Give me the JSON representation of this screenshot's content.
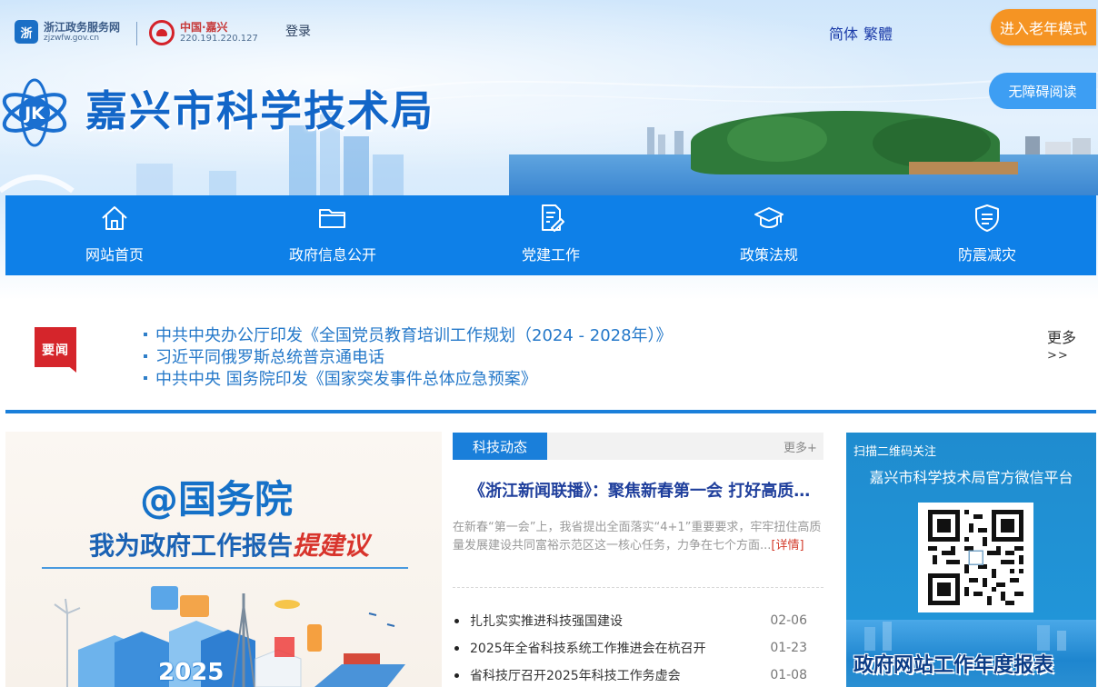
{
  "header": {
    "zj_portal_name": "浙江政务服务网",
    "zj_portal_domain": "zjzwfw.gov.cn",
    "zj_logo_glyph": "浙",
    "cn_region_name": "中国·嘉兴",
    "cn_region_ip": "220.191.220.127",
    "login_label": "登录",
    "lang_simplified": "简体",
    "lang_traditional": "繁體",
    "elder_mode_label": "进入老年模式",
    "accessibility_label": "无障碍阅读",
    "site_title": "嘉兴市科学技术局",
    "logo_letters": "JK"
  },
  "colors": {
    "nav_blue": "#0e80e8",
    "accent_orange": "#f59423",
    "badge_red": "#d5252b",
    "link_blue": "#2478c9",
    "headline_blue": "#1f3f9c"
  },
  "nav": {
    "items": [
      {
        "label": "网站首页",
        "icon": "home-icon"
      },
      {
        "label": "政府信息公开",
        "icon": "folder-icon"
      },
      {
        "label": "党建工作",
        "icon": "document-edit-icon"
      },
      {
        "label": "政策法规",
        "icon": "graduation-cap-icon"
      },
      {
        "label": "防震减灾",
        "icon": "shield-icon"
      }
    ]
  },
  "news": {
    "badge": "要闻",
    "items": [
      "中共中央办公厅印发《全国党员教育培训工作规划（2024 - 2028年）》",
      "习近平同俄罗斯总统普京通电话",
      "中共中央 国务院印发《国家突发事件总体应急预案》"
    ],
    "more_label": "更多",
    "more_arrow": ">>"
  },
  "promo": {
    "line1": "@国务院",
    "line2_main": "我为政府工作报告",
    "line2_emph": "提建议",
    "year": "2025"
  },
  "tech": {
    "tab_label": "科技动态",
    "more_label": "更多+",
    "headline": "《浙江新闻联播》：聚焦新春第一会 打好高质量发展组合拳",
    "summary": "在新春“第一会”上，我省提出全面落实“4+1”重要要求，牢牢扭住高质量发展建设共同富裕示范区这一核心任务，力争在七个方面...",
    "detail_label": "[详情]",
    "items": [
      {
        "title": "扎扎实实推进科技强国建设",
        "date": "02-06"
      },
      {
        "title": "2025年全省科技系统工作推进会在杭召开",
        "date": "01-23"
      },
      {
        "title": "省科技厅召开2025年科技工作务虚会",
        "date": "01-08"
      }
    ]
  },
  "wechat": {
    "scan_label": "扫描二维码关注",
    "platform_name": "嘉兴市科学技术局官方微信平台"
  },
  "report": {
    "label": "政府网站工作年度报表"
  }
}
